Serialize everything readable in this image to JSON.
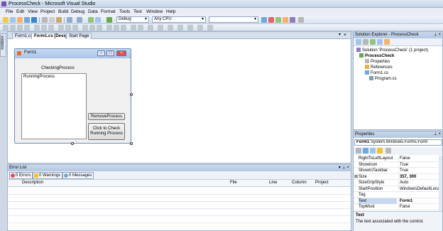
{
  "window": {
    "title": "ProcessCheck - Microsoft Visual Studio"
  },
  "menu": [
    "File",
    "Edit",
    "View",
    "Project",
    "Build",
    "Debug",
    "Data",
    "Format",
    "Tools",
    "Test",
    "Window",
    "Help"
  ],
  "toolbar": {
    "config": "Debug",
    "platform": "Any CPU"
  },
  "left_dock": {
    "toolbox_label": "Toolbox"
  },
  "doc_tabs": [
    "Form1.cs",
    "Form1.cs [Design]",
    "Start Page"
  ],
  "form1": {
    "title": "Form1",
    "label_checking": "CheckingProcess",
    "list_item": "RunningProcess",
    "remove_button": "RemoveProcess",
    "check_button": "Click to Check Running Process"
  },
  "error_list": {
    "title": "Error List",
    "filters": {
      "errors": "0 Errors",
      "warnings": "0 Warnings",
      "messages": "0 Messages"
    },
    "columns": [
      "Description",
      "File",
      "Line",
      "Column",
      "Project"
    ]
  },
  "solution_explorer": {
    "title": "Solution Explorer - ProcessCheck",
    "items": [
      "Solution 'ProcessCheck' (1 project)",
      "ProcessCheck",
      "Properties",
      "References",
      "Form1.cs",
      "Program.cs"
    ]
  },
  "properties": {
    "title": "Properties",
    "object_name": "Form1",
    "object_type": "System.Windows.Forms.Form",
    "rows": [
      {
        "name": "RightToLeftLayout",
        "value": "False"
      },
      {
        "name": "ShowIcon",
        "value": "True"
      },
      {
        "name": "ShowInTaskbar",
        "value": "True"
      },
      {
        "name": "Size",
        "value": "357, 300"
      },
      {
        "name": "SizeGripStyle",
        "value": "Auto"
      },
      {
        "name": "StartPosition",
        "value": "WindowsDefaultLocation"
      },
      {
        "name": "Tag",
        "value": ""
      },
      {
        "name": "Text",
        "value": "Form1"
      },
      {
        "name": "TopMost",
        "value": "False"
      }
    ],
    "desc_title": "Text",
    "desc_text": "The text associated with the control."
  }
}
